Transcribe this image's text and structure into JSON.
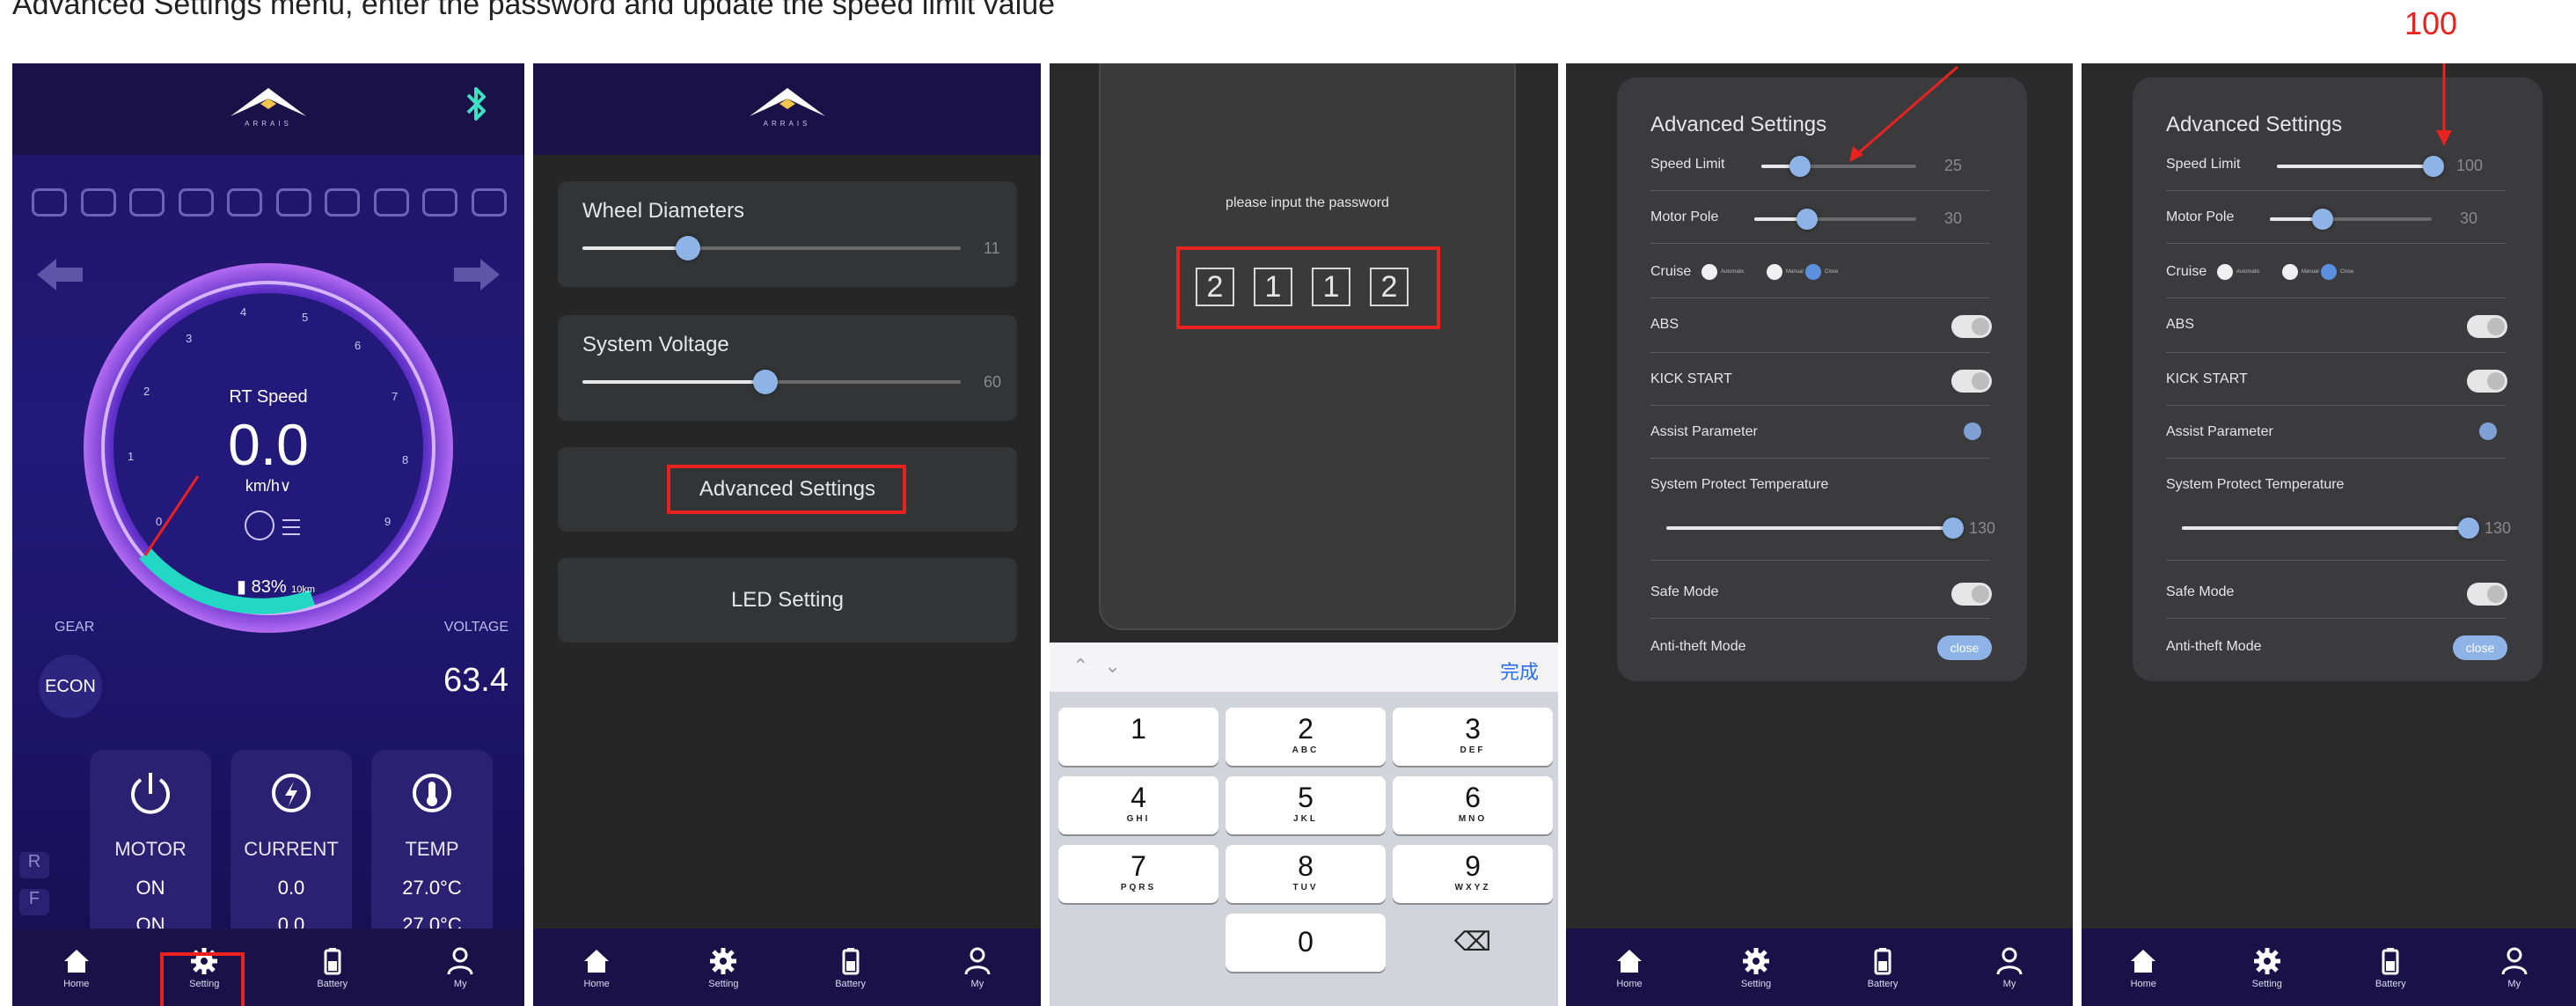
{
  "headline": "Advanced Settings menu, enter the password and update the speed limit value",
  "annotation_value": "100",
  "colors": {
    "highlight": "#e8231f",
    "accent": "#8eb3e6",
    "dashboard_bg": "#23197a"
  },
  "brand": {
    "logo_text": "ARRAIS",
    "logo_icon": "mountain-logo-icon"
  },
  "bottom_nav": [
    {
      "label": "Home",
      "icon": "home-icon"
    },
    {
      "label": "Setting",
      "icon": "gear-icon"
    },
    {
      "label": "Battery",
      "icon": "battery-icon"
    },
    {
      "label": "My",
      "icon": "person-icon"
    }
  ],
  "dashboard": {
    "speed_label": "RT Speed",
    "speed_value": "0.0",
    "speed_unit": "km/h∨",
    "battery_percent": "83%",
    "range": "10km",
    "gauge_ticks": [
      "0",
      "1",
      "2",
      "3",
      "4",
      "5",
      "6",
      "7",
      "8",
      "9"
    ],
    "gear_label": "GEAR",
    "gear_value": "ECON",
    "voltage_label": "VOLTAGE",
    "voltage_value": "63.4",
    "status_cards": [
      {
        "title": "MOTOR",
        "values": [
          "ON",
          "ON"
        ],
        "icon": "power-icon"
      },
      {
        "title": "CURRENT",
        "values": [
          "0.0",
          "0.0"
        ],
        "icon": "bolt-icon"
      },
      {
        "title": "TEMP",
        "values": [
          "27.0°C",
          "27.0°C"
        ],
        "icon": "thermometer-icon"
      }
    ],
    "row_markers": [
      "R",
      "F"
    ]
  },
  "settings": {
    "wheel_title": "Wheel Diameters",
    "wheel_value": "11",
    "voltage_title": "System Voltage",
    "voltage_value": "60",
    "advanced_label": "Advanced Settings",
    "led_label": "LED Setting"
  },
  "password": {
    "message": "please input the password",
    "digits": [
      "2",
      "1",
      "1",
      "2"
    ],
    "done_label": "完成",
    "keys": [
      {
        "n": "1",
        "s": ""
      },
      {
        "n": "2",
        "s": "ABC"
      },
      {
        "n": "3",
        "s": "DEF"
      },
      {
        "n": "4",
        "s": "GHI"
      },
      {
        "n": "5",
        "s": "JKL"
      },
      {
        "n": "6",
        "s": "MNO"
      },
      {
        "n": "7",
        "s": "PQRS"
      },
      {
        "n": "8",
        "s": "TUV"
      },
      {
        "n": "9",
        "s": "WXYZ"
      },
      {
        "n": "0",
        "s": ""
      }
    ]
  },
  "advanced_before": {
    "title": "Advanced Settings",
    "speed_limit_label": "Speed Limit",
    "speed_limit_value": "25",
    "motor_pole_label": "Motor Pole",
    "motor_pole_value": "30",
    "cruise_label": "Cruise",
    "cruise_options": [
      "Automatic",
      "Manual",
      "Close"
    ],
    "abs_label": "ABS",
    "kick_label": "KICK START",
    "assist_label": "Assist Parameter",
    "temp_label": "System Protect Temperature",
    "temp_value": "130",
    "safe_label": "Safe Mode",
    "antitheft_label": "Anti-theft Mode",
    "antitheft_value": "close"
  },
  "advanced_after": {
    "title": "Advanced Settings",
    "speed_limit_label": "Speed Limit",
    "speed_limit_value": "100",
    "motor_pole_label": "Motor Pole",
    "motor_pole_value": "30",
    "cruise_label": "Cruise",
    "cruise_options": [
      "Automatic",
      "Manual",
      "Close"
    ],
    "abs_label": "ABS",
    "kick_label": "KICK START",
    "assist_label": "Assist Parameter",
    "temp_label": "System Protect Temperature",
    "temp_value": "130",
    "safe_label": "Safe Mode",
    "antitheft_label": "Anti-theft Mode",
    "antitheft_value": "close"
  }
}
